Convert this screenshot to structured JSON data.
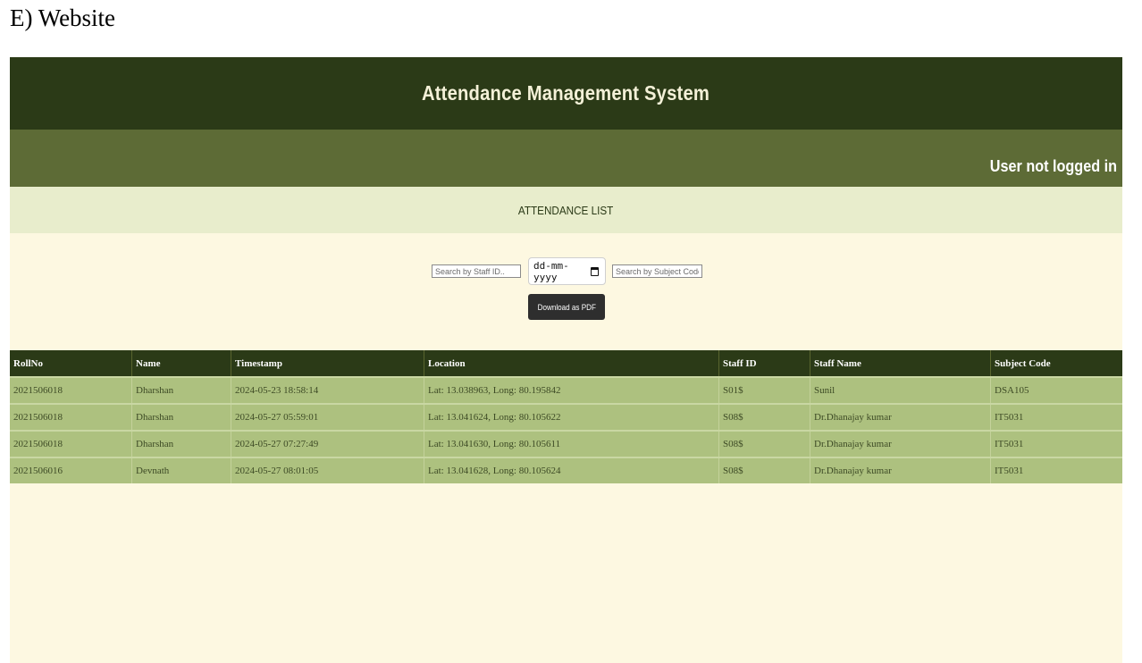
{
  "caption": "E) Website",
  "header": {
    "title": "Attendance Management System"
  },
  "subbar": {
    "login_status": "User not logged in"
  },
  "section": {
    "title": "ATTENDANCE LIST"
  },
  "filters": {
    "staff_placeholder": "Search by Staff ID..",
    "date_placeholder": "dd-mm-yyyy",
    "subject_placeholder": "Search by Subject Code..",
    "download_label": "Download as PDF"
  },
  "table": {
    "columns": [
      "RollNo",
      "Name",
      "Timestamp",
      "Location",
      "Staff ID",
      "Staff Name",
      "Subject Code"
    ],
    "rows": [
      [
        "2021506018",
        "Dharshan",
        "2024-05-23 18:58:14",
        "Lat: 13.038963, Long: 80.195842",
        "S01$",
        "Sunil",
        "DSA105"
      ],
      [
        "2021506018",
        "Dharshan",
        "2024-05-27 05:59:01",
        "Lat: 13.041624, Long: 80.105622",
        "S08$",
        "Dr.Dhanajay kumar",
        "IT5031"
      ],
      [
        "2021506018",
        "Dharshan",
        "2024-05-27 07:27:49",
        "Lat: 13.041630, Long: 80.105611",
        "S08$",
        "Dr.Dhanajay kumar",
        "IT5031"
      ],
      [
        "2021506016",
        "Devnath",
        "2024-05-27 08:01:05",
        "Lat: 13.041628, Long: 80.105624",
        "S08$",
        "Dr.Dhanajay kumar",
        "IT5031"
      ]
    ]
  },
  "colors": {
    "header_bg": "#2b3a17",
    "subbar_bg": "#5d6b36",
    "section_bg": "#e8edcc",
    "page_bg": "#fdf8e1",
    "row_bg": "#adc17f"
  }
}
